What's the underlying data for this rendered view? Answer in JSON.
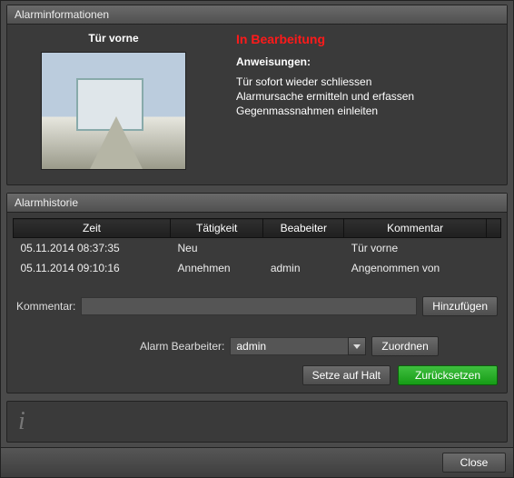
{
  "panels": {
    "info_title": "Alarminformationen",
    "history_title": "Alarmhistorie"
  },
  "info": {
    "camera_label": "Tür vorne",
    "status": "In Bearbeitung",
    "instructions_header": "Anweisungen:",
    "instructions": [
      "Tür sofort wieder schliessen",
      "Alarmursache ermitteln und erfassen",
      "Gegenmassnahmen einleiten"
    ]
  },
  "history": {
    "columns": {
      "time": "Zeit",
      "activity": "Tätigkeit",
      "editor": "Beabeiter",
      "comment": "Kommentar"
    },
    "rows": [
      {
        "time": "05.11.2014 08:37:35",
        "activity": "Neu",
        "editor": "",
        "comment": "Tür vorne"
      },
      {
        "time": "05.11.2014 09:10:16",
        "activity": "Annehmen",
        "editor": "admin",
        "comment": "Angenommen von"
      }
    ]
  },
  "form": {
    "comment_label": "Kommentar:",
    "comment_value": "",
    "add_btn": "Hinzufügen",
    "assign_label": "Alarm Bearbeiter:",
    "assign_value": "admin",
    "assign_btn": "Zuordnen",
    "hold_btn": "Setze auf Halt",
    "reset_btn": "Zurücksetzen"
  },
  "footer": {
    "close_btn": "Close"
  }
}
